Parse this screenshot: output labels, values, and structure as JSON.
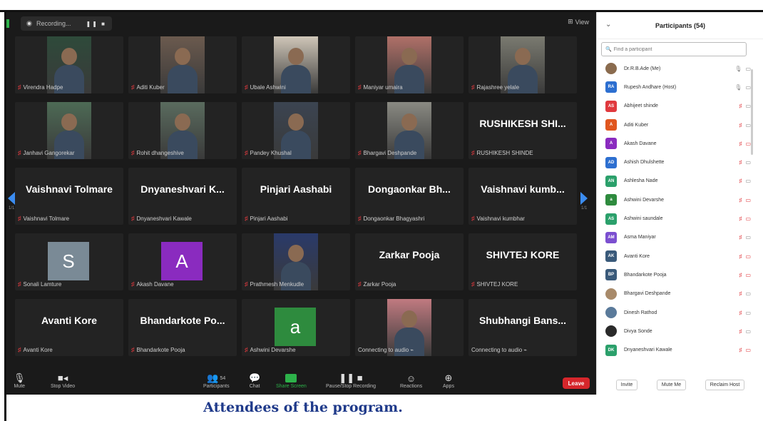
{
  "recording": {
    "label": "Recording...",
    "controls": "❚❚ ■"
  },
  "view": {
    "label": "View",
    "icon": "grid-icon"
  },
  "tiles": [
    {
      "name": "Virendra Hadpe",
      "type": "video",
      "bg": "#2e4a3a"
    },
    {
      "name": "Aditi Kuber",
      "type": "video",
      "bg": "#6b5a4e"
    },
    {
      "name": "Ubale Ashwini",
      "type": "video",
      "bg": "#cfc6b8"
    },
    {
      "name": "Maniyar umaira",
      "type": "video",
      "bg": "#b07068"
    },
    {
      "name": "Rajashree yelale",
      "type": "video",
      "bg": "#7a7a70"
    },
    {
      "name": "Janhavi Gangorekar",
      "type": "video",
      "bg": "#4d6a55"
    },
    {
      "name": "Rohit dhangeshive",
      "type": "video",
      "bg": "#5a6b5e"
    },
    {
      "name": "Pandey Khushal",
      "type": "video",
      "bg": "#3b4451"
    },
    {
      "name": "Bhargavi Deshpande",
      "type": "video",
      "bg": "#8a8a82"
    },
    {
      "name": "RUSHIKESH SHINDE",
      "type": "text",
      "big": "RUSHIKESH SHI..."
    },
    {
      "name": "Vaishnavi Tolmare",
      "type": "text",
      "big": "Vaishnavi Tolmare"
    },
    {
      "name": "Dnyaneshvari Kawale",
      "type": "text",
      "big": "Dnyaneshvari K..."
    },
    {
      "name": "Pinjari Aashabi",
      "type": "text",
      "big": "Pinjari Aashabi"
    },
    {
      "name": "Dongaonkar Bhagyashri",
      "type": "text",
      "big": "Dongaonkar Bh..."
    },
    {
      "name": "Vaishnavi kumbhar",
      "type": "text",
      "big": "Vaishnavi kumb..."
    },
    {
      "name": "Sonali Lamture",
      "type": "avatar",
      "letter": "S",
      "color": "#7a8a96"
    },
    {
      "name": "Akash Davane",
      "type": "avatar",
      "letter": "A",
      "color": "#8a2bbf"
    },
    {
      "name": "Prathmesh Menkudle",
      "type": "video",
      "bg": "#2a3a6a"
    },
    {
      "name": "Zarkar Pooja",
      "type": "text",
      "big": "Zarkar Pooja"
    },
    {
      "name": "SHIVTEJ KORE",
      "type": "text",
      "big": "SHIVTEJ KORE"
    },
    {
      "name": "Avanti Kore",
      "type": "text",
      "big": "Avanti Kore"
    },
    {
      "name": "Bhandarkote Pooja",
      "type": "text",
      "big": "Bhandarkote Po..."
    },
    {
      "name": "Ashwini Devarshe",
      "type": "avatar",
      "letter": "a",
      "color": "#2e8b3e"
    },
    {
      "name": "Connecting to audio",
      "type": "video",
      "bg": "#c07a80",
      "connecting": true
    },
    {
      "name": "Connecting to audio",
      "type": "text",
      "big": "Shubhangi Bans...",
      "connecting": true
    }
  ],
  "toolbar": {
    "mute": "Mute",
    "stop_video": "Stop Video",
    "participants": "Participants",
    "participants_count": "54",
    "chat": "Chat",
    "share": "Share Screen",
    "record": "Pause/Stop Recording",
    "reactions": "Reactions",
    "apps": "Apps",
    "leave": "Leave"
  },
  "panel": {
    "title": "Participants (54)",
    "search_placeholder": "Find a participant",
    "participants": [
      {
        "initials": "",
        "name": "Dr.R.B.Ade (Me)",
        "color": "#8a6b4e",
        "mic": "on",
        "video": "off-gray",
        "photo": true
      },
      {
        "initials": "RA",
        "name": "Rupesh Andhare (Host)",
        "color": "#2d6fd0",
        "mic": "on",
        "video": "off-gray"
      },
      {
        "initials": "AS",
        "name": "Abhijeet shinde",
        "color": "#e0393e",
        "mic": "off",
        "video": "off-gray"
      },
      {
        "initials": "A",
        "name": "Aditi Kuber",
        "color": "#e0561f",
        "mic": "off",
        "video": "off-gray"
      },
      {
        "initials": "A",
        "name": "Akash Davane",
        "color": "#8a2bbf",
        "mic": "off",
        "video": "off"
      },
      {
        "initials": "AD",
        "name": "Ashish Dhulshette",
        "color": "#2d6fd0",
        "mic": "off",
        "video": "off-gray"
      },
      {
        "initials": "AN",
        "name": "Ashlesha Nade",
        "color": "#2ba06b",
        "mic": "off",
        "video": "off-gray"
      },
      {
        "initials": "a",
        "name": "Ashwini Devarshe",
        "color": "#2e8b3e",
        "mic": "off",
        "video": "off"
      },
      {
        "initials": "AS",
        "name": "Ashwini saundale",
        "color": "#2ba06b",
        "mic": "off",
        "video": "off"
      },
      {
        "initials": "AM",
        "name": "Asma Maniyar",
        "color": "#7b4fd0",
        "mic": "off",
        "video": "off-gray"
      },
      {
        "initials": "AK",
        "name": "Avanti Kore",
        "color": "#3a5a7a",
        "mic": "off",
        "video": "off"
      },
      {
        "initials": "BP",
        "name": "Bhandarkote Pooja",
        "color": "#3a5a7a",
        "mic": "off",
        "video": "off"
      },
      {
        "initials": "",
        "name": "Bhargavi Deshpande",
        "color": "#a88a6a",
        "mic": "off",
        "video": "off-gray",
        "photo": true
      },
      {
        "initials": "",
        "name": "Dinesh Rathod",
        "color": "#5a7a9a",
        "mic": "off",
        "video": "off-gray",
        "photo": true
      },
      {
        "initials": "",
        "name": "Divya Sonde",
        "color": "#2a2a2a",
        "mic": "off",
        "video": "off-gray",
        "photo": true
      },
      {
        "initials": "DK",
        "name": "Dnyaneshvari Kawale",
        "color": "#2ba06b",
        "mic": "off",
        "video": "off"
      }
    ],
    "invite": "Invite",
    "mute_me": "Mute Me",
    "reclaim_host": "Reclaim Host"
  },
  "caption": "Attendees of the program.",
  "colors": {
    "accent": "#2db24a",
    "leave": "#d6262b",
    "caption": "#1f3a8a",
    "mic_off": "#e0393e"
  }
}
